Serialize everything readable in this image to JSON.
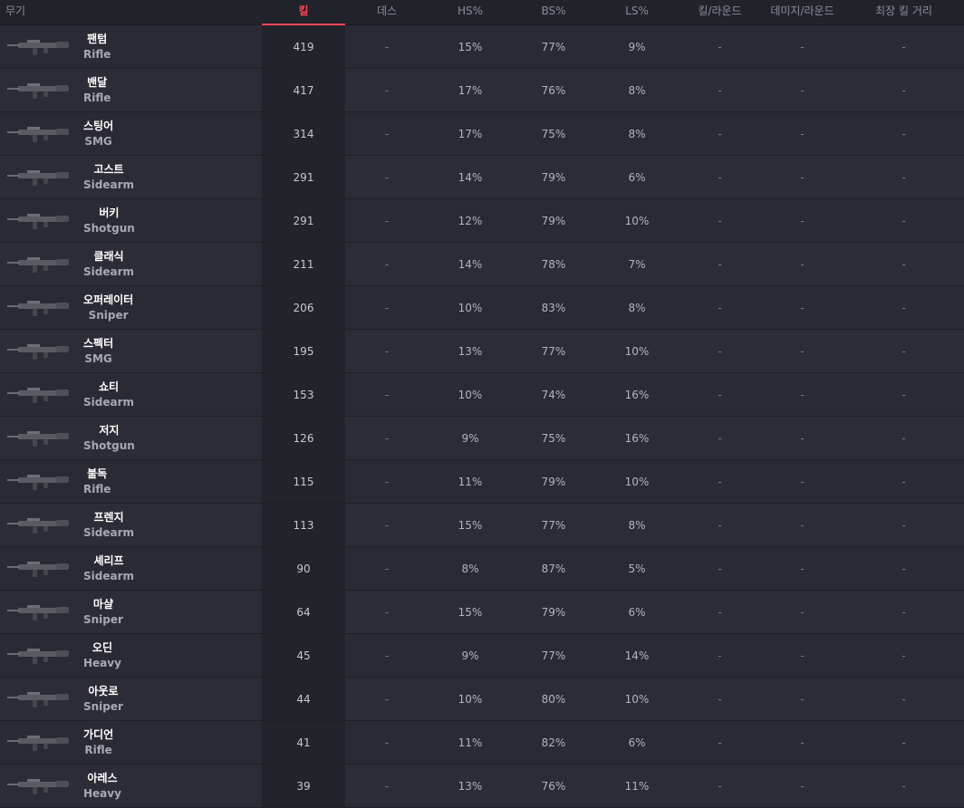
{
  "headers": {
    "weapon": "무기",
    "kills": "킬",
    "deaths": "데스",
    "hs": "HS%",
    "bs": "BS%",
    "ls": "LS%",
    "kpr": "킬/라운드",
    "dpr": "데미지/라운드",
    "longest": "최장 킬 거리"
  },
  "colors": {
    "accent": "#ff4655",
    "background": "#2a2a34",
    "kills_column": "#23232c"
  },
  "rows": [
    {
      "name": "팬텀",
      "type": "Rifle",
      "kills": "419",
      "deaths": "-",
      "hs": "15%",
      "bs": "77%",
      "ls": "9%",
      "kpr": "-",
      "dpr": "-",
      "longest": "-",
      "icon": "phantom-icon"
    },
    {
      "name": "밴달",
      "type": "Rifle",
      "kills": "417",
      "deaths": "-",
      "hs": "17%",
      "bs": "76%",
      "ls": "8%",
      "kpr": "-",
      "dpr": "-",
      "longest": "-",
      "icon": "vandal-icon"
    },
    {
      "name": "스팅어",
      "type": "SMG",
      "kills": "314",
      "deaths": "-",
      "hs": "17%",
      "bs": "75%",
      "ls": "8%",
      "kpr": "-",
      "dpr": "-",
      "longest": "-",
      "icon": "stinger-icon"
    },
    {
      "name": "고스트",
      "type": "Sidearm",
      "kills": "291",
      "deaths": "-",
      "hs": "14%",
      "bs": "79%",
      "ls": "6%",
      "kpr": "-",
      "dpr": "-",
      "longest": "-",
      "icon": "ghost-icon"
    },
    {
      "name": "버키",
      "type": "Shotgun",
      "kills": "291",
      "deaths": "-",
      "hs": "12%",
      "bs": "79%",
      "ls": "10%",
      "kpr": "-",
      "dpr": "-",
      "longest": "-",
      "icon": "bucky-icon"
    },
    {
      "name": "클래식",
      "type": "Sidearm",
      "kills": "211",
      "deaths": "-",
      "hs": "14%",
      "bs": "78%",
      "ls": "7%",
      "kpr": "-",
      "dpr": "-",
      "longest": "-",
      "icon": "classic-icon"
    },
    {
      "name": "오퍼레이터",
      "type": "Sniper",
      "kills": "206",
      "deaths": "-",
      "hs": "10%",
      "bs": "83%",
      "ls": "8%",
      "kpr": "-",
      "dpr": "-",
      "longest": "-",
      "icon": "operator-icon"
    },
    {
      "name": "스펙터",
      "type": "SMG",
      "kills": "195",
      "deaths": "-",
      "hs": "13%",
      "bs": "77%",
      "ls": "10%",
      "kpr": "-",
      "dpr": "-",
      "longest": "-",
      "icon": "spectre-icon"
    },
    {
      "name": "쇼티",
      "type": "Sidearm",
      "kills": "153",
      "deaths": "-",
      "hs": "10%",
      "bs": "74%",
      "ls": "16%",
      "kpr": "-",
      "dpr": "-",
      "longest": "-",
      "icon": "shorty-icon"
    },
    {
      "name": "저지",
      "type": "Shotgun",
      "kills": "126",
      "deaths": "-",
      "hs": "9%",
      "bs": "75%",
      "ls": "16%",
      "kpr": "-",
      "dpr": "-",
      "longest": "-",
      "icon": "judge-icon"
    },
    {
      "name": "불독",
      "type": "Rifle",
      "kills": "115",
      "deaths": "-",
      "hs": "11%",
      "bs": "79%",
      "ls": "10%",
      "kpr": "-",
      "dpr": "-",
      "longest": "-",
      "icon": "bulldog-icon"
    },
    {
      "name": "프렌지",
      "type": "Sidearm",
      "kills": "113",
      "deaths": "-",
      "hs": "15%",
      "bs": "77%",
      "ls": "8%",
      "kpr": "-",
      "dpr": "-",
      "longest": "-",
      "icon": "frenzy-icon"
    },
    {
      "name": "셰리프",
      "type": "Sidearm",
      "kills": "90",
      "deaths": "-",
      "hs": "8%",
      "bs": "87%",
      "ls": "5%",
      "kpr": "-",
      "dpr": "-",
      "longest": "-",
      "icon": "sheriff-icon"
    },
    {
      "name": "마샬",
      "type": "Sniper",
      "kills": "64",
      "deaths": "-",
      "hs": "15%",
      "bs": "79%",
      "ls": "6%",
      "kpr": "-",
      "dpr": "-",
      "longest": "-",
      "icon": "marshal-icon"
    },
    {
      "name": "오딘",
      "type": "Heavy",
      "kills": "45",
      "deaths": "-",
      "hs": "9%",
      "bs": "77%",
      "ls": "14%",
      "kpr": "-",
      "dpr": "-",
      "longest": "-",
      "icon": "odin-icon"
    },
    {
      "name": "아웃로",
      "type": "Sniper",
      "kills": "44",
      "deaths": "-",
      "hs": "10%",
      "bs": "80%",
      "ls": "10%",
      "kpr": "-",
      "dpr": "-",
      "longest": "-",
      "icon": "outlaw-icon"
    },
    {
      "name": "가디언",
      "type": "Rifle",
      "kills": "41",
      "deaths": "-",
      "hs": "11%",
      "bs": "82%",
      "ls": "6%",
      "kpr": "-",
      "dpr": "-",
      "longest": "-",
      "icon": "guardian-icon"
    },
    {
      "name": "아레스",
      "type": "Heavy",
      "kills": "39",
      "deaths": "-",
      "hs": "13%",
      "bs": "76%",
      "ls": "11%",
      "kpr": "-",
      "dpr": "-",
      "longest": "-",
      "icon": "ares-icon"
    }
  ]
}
